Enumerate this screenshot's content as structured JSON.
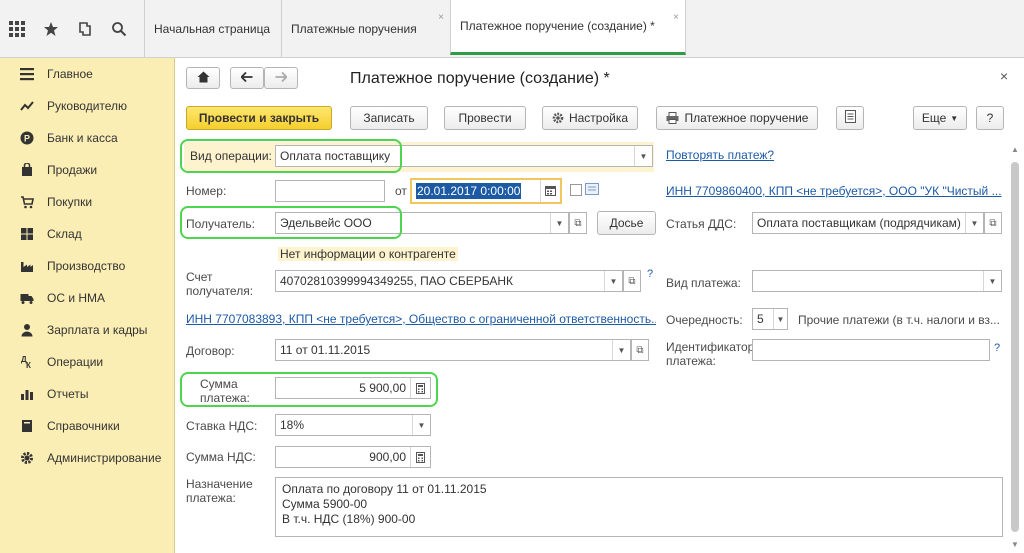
{
  "toolbar_icons": [
    "apps-grid-icon",
    "star-icon",
    "history-icon",
    "search-icon"
  ],
  "tabs": [
    {
      "label": "Начальная страница"
    },
    {
      "label": "Платежные поручения",
      "close": "×"
    },
    {
      "label": "Платежное поручение (создание) *",
      "close": "×"
    }
  ],
  "sidebar": {
    "items": [
      {
        "label": "Главное",
        "icon": "menu-icon"
      },
      {
        "label": "Руководителю",
        "icon": "trend-icon"
      },
      {
        "label": "Банк и касса",
        "icon": "coin-icon"
      },
      {
        "label": "Продажи",
        "icon": "bag-icon"
      },
      {
        "label": "Покупки",
        "icon": "cart-icon"
      },
      {
        "label": "Склад",
        "icon": "warehouse-icon"
      },
      {
        "label": "Производство",
        "icon": "factory-icon"
      },
      {
        "label": "ОС и НМА",
        "icon": "truck-icon"
      },
      {
        "label": "Зарплата и кадры",
        "icon": "person-icon"
      },
      {
        "label": "Операции",
        "icon": "operations-icon"
      },
      {
        "label": "Отчеты",
        "icon": "chart-icon"
      },
      {
        "label": "Справочники",
        "icon": "book-icon"
      },
      {
        "label": "Администрирование",
        "icon": "gear-icon"
      }
    ]
  },
  "form": {
    "title": "Платежное поручение (создание) *",
    "close": "×",
    "buttons": {
      "post_close": "Провести и закрыть",
      "save": "Записать",
      "post": "Провести",
      "settings": "Настройка",
      "print": "Платежное поручение",
      "more": "Еще",
      "help": "?"
    },
    "operation_type_label": "Вид операции:",
    "operation_type_value": "Оплата поставщику",
    "repeat_link": "Повторять платеж?",
    "number_label": "Номер:",
    "number_value": "",
    "date_from_label": "от",
    "date_value": "20.01.2017  0:00:00",
    "org_link": "ИНН 7709860400, КПП <не требуется>, ООО \"УК \"Чистый ...",
    "recipient_label": "Получатель:",
    "recipient_value": "Эдельвейс ООО",
    "dossier": "Досье",
    "dds_label": "Статья ДДС:",
    "dds_value": "Оплата поставщикам (подрядчикам)",
    "no_info": "Нет информации о контрагенте",
    "account_label": "Счет получателя:",
    "account_value": "40702810399994349255, ПАО СБЕРБАНК",
    "payment_kind_label": "Вид платежа:",
    "payment_kind_value": "",
    "recipient_inn_link": "ИНН 7707083893, КПП <не требуется>, Общество с ограниченной ответственность...",
    "priority_label": "Очередность:",
    "priority_value": "5",
    "priority_desc": "Прочие платежи (в т.ч. налоги и вз...",
    "contract_label": "Договор:",
    "contract_value": "11 от 01.11.2015",
    "payment_id_label": "Идентификатор платежа:",
    "payment_id_value": "",
    "amount_label": "Сумма платежа:",
    "amount_value": "5 900,00",
    "vat_rate_label": "Ставка НДС:",
    "vat_rate_value": "18%",
    "vat_amount_label": "Сумма НДС:",
    "vat_amount_value": "900,00",
    "purpose_label": "Назначение платежа:",
    "purpose_value": "Оплата по договору 11 от 01.11.2015\nСумма 5900-00\nВ т.ч. НДС  (18%) 900-00",
    "qmark": "?"
  },
  "colors": {
    "accent": "#2e9b47",
    "sidebar": "#fbeeb4",
    "primary_button": "#f5cf2e",
    "highlight": "#4fd44f",
    "link": "#1c5aa6"
  }
}
